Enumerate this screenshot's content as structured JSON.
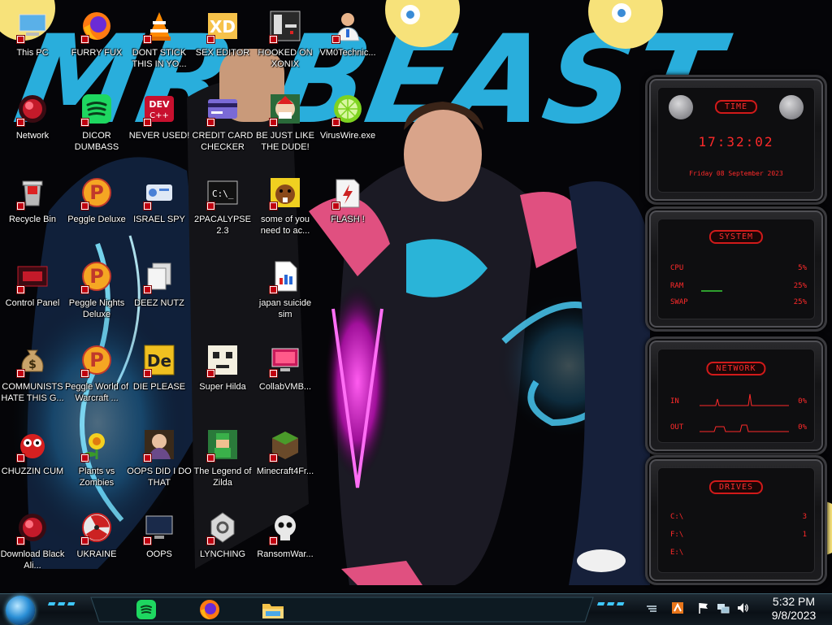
{
  "desktop": {
    "icons": [
      {
        "label": "This PC",
        "icon": "this-pc-icon",
        "col": 0,
        "row": 0
      },
      {
        "label": "FURRY FUX",
        "icon": "firefox-icon",
        "col": 1,
        "row": 0
      },
      {
        "label": "DONT STICK THIS IN YO...",
        "icon": "vlc-icon",
        "col": 2,
        "row": 0
      },
      {
        "label": "SEX EDITOR",
        "icon": "xd-editor-icon",
        "col": 3,
        "row": 0
      },
      {
        "label": "HOOKED ON XONIX",
        "icon": "xonix-icon",
        "col": 4,
        "row": 0
      },
      {
        "label": "VM0Technic...",
        "icon": "doctor-icon",
        "col": 5,
        "row": 0
      },
      {
        "label": "Network",
        "icon": "network-icon",
        "col": 0,
        "row": 1
      },
      {
        "label": "DICOR DUMBASS",
        "icon": "spotify-icon",
        "col": 1,
        "row": 1
      },
      {
        "label": "NEVER USED!",
        "icon": "dev-cpp-icon",
        "col": 2,
        "row": 1
      },
      {
        "label": "CREDIT CARD CHECKER",
        "icon": "credit-card-icon",
        "col": 3,
        "row": 1
      },
      {
        "label": "BE JUST LIKE THE DUDE!",
        "icon": "dude-icon",
        "col": 4,
        "row": 1
      },
      {
        "label": "VirusWire.exe",
        "icon": "lime-icon",
        "col": 5,
        "row": 1
      },
      {
        "label": "Recycle Bin",
        "icon": "recycle-bin-icon",
        "col": 0,
        "row": 2
      },
      {
        "label": "Peggle Deluxe",
        "icon": "peggle-icon",
        "col": 1,
        "row": 2
      },
      {
        "label": "ISRAEL SPY",
        "icon": "spy-icon",
        "col": 2,
        "row": 2
      },
      {
        "label": "2PACALYPSE 2.3",
        "icon": "terminal-icon",
        "col": 3,
        "row": 2
      },
      {
        "label": "some of you need to ac...",
        "icon": "beaver-icon",
        "col": 4,
        "row": 2
      },
      {
        "label": "FLASH !",
        "icon": "flash-icon",
        "col": 5,
        "row": 2
      },
      {
        "label": "Control Panel",
        "icon": "control-panel-icon",
        "col": 0,
        "row": 3
      },
      {
        "label": "Peggle Nights Deluxe",
        "icon": "peggle-icon",
        "col": 1,
        "row": 3
      },
      {
        "label": "DEEZ NUTZ",
        "icon": "copy-icon",
        "col": 2,
        "row": 3
      },
      {
        "label": "japan suicide sim",
        "icon": "document-icon",
        "col": 4,
        "row": 3
      },
      {
        "label": "COMMUNISTS HATE THIS G...",
        "icon": "money-bag-icon",
        "col": 0,
        "row": 4
      },
      {
        "label": "Peggle World of Warcraft ...",
        "icon": "peggle-icon",
        "col": 1,
        "row": 4
      },
      {
        "label": "DIE PLEASE",
        "icon": "de-icon",
        "col": 2,
        "row": 4
      },
      {
        "label": "Super Hilda",
        "icon": "hilda-icon",
        "col": 3,
        "row": 4
      },
      {
        "label": "CollabVMB...",
        "icon": "collabvm-icon",
        "col": 4,
        "row": 4
      },
      {
        "label": "CHUZZIN CUM",
        "icon": "chuzzle-icon",
        "col": 0,
        "row": 5
      },
      {
        "label": "Plants vs Zombies",
        "icon": "plants-icon",
        "col": 1,
        "row": 5
      },
      {
        "label": "OOPS DID I DO THAT",
        "icon": "portrait-icon",
        "col": 2,
        "row": 5
      },
      {
        "label": "The Legend of Zilda",
        "icon": "zilda-icon",
        "col": 3,
        "row": 5
      },
      {
        "label": "Minecraft4Fr...",
        "icon": "minecraft-icon",
        "col": 4,
        "row": 5
      },
      {
        "label": "Download Black Ali...",
        "icon": "network-icon",
        "col": 0,
        "row": 6
      },
      {
        "label": "UKRAINE",
        "icon": "radiation-icon",
        "col": 1,
        "row": 6
      },
      {
        "label": "OOPS",
        "icon": "monitor-icon",
        "col": 2,
        "row": 6
      },
      {
        "label": "LYNCHING",
        "icon": "lynch-icon",
        "col": 3,
        "row": 6
      },
      {
        "label": "RansomWar...",
        "icon": "skull-icon",
        "col": 4,
        "row": 6
      }
    ]
  },
  "wallpaper": {
    "banner_text": "MR BEAST"
  },
  "gadgets": {
    "time": {
      "title": "TIME",
      "clock": "17:32:02",
      "date": "Friday 08 September 2023"
    },
    "system": {
      "title": "SYSTEM",
      "rows": [
        {
          "label": "CPU",
          "value": "5%"
        },
        {
          "label": "RAM",
          "value": "25%"
        },
        {
          "label": "SWAP",
          "value": "25%"
        }
      ]
    },
    "network": {
      "title": "NETWORK",
      "rows": [
        {
          "label": "IN",
          "value": "0%"
        },
        {
          "label": "OUT",
          "value": "0%"
        }
      ]
    },
    "drives": {
      "title": "DRIVES",
      "rows": [
        {
          "label": "C:\\",
          "value": "3"
        },
        {
          "label": "F:\\",
          "value": "1"
        },
        {
          "label": "E:\\",
          "value": ""
        }
      ]
    }
  },
  "taskbar": {
    "apps": [
      {
        "name": "spotify",
        "icon": "spotify-icon"
      },
      {
        "name": "firefox",
        "icon": "firefox-icon"
      },
      {
        "name": "file-explorer",
        "icon": "folder-icon"
      }
    ],
    "clock": {
      "time": "5:32 PM",
      "date": "9/8/2023"
    }
  },
  "colors": {
    "gadget_red": "#ff2a2a",
    "wallpaper_cyan": "#2bb8e8",
    "taskbar": "#0a1016"
  }
}
